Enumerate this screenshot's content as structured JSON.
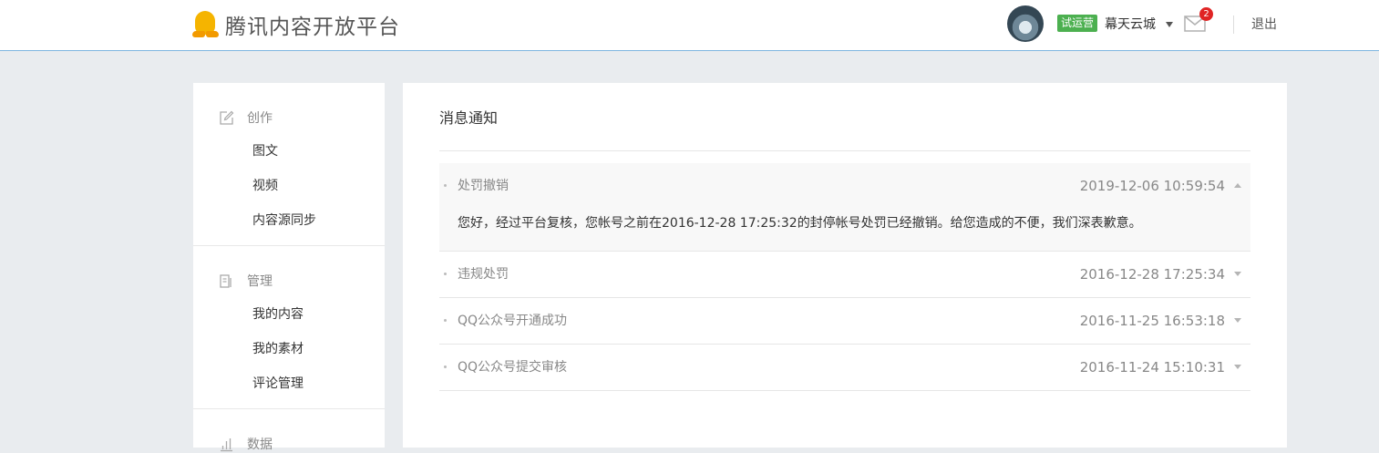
{
  "header": {
    "brand": "腾讯内容开放平台",
    "trial_badge": "试运营",
    "username": "幕天云城",
    "mail_count": "2",
    "logout": "退出"
  },
  "sidebar": {
    "groups": [
      {
        "label": "创作",
        "icon": "edit-icon",
        "items": [
          "图文",
          "视频",
          "内容源同步"
        ]
      },
      {
        "label": "管理",
        "icon": "manage-icon",
        "items": [
          "我的内容",
          "我的素材",
          "评论管理"
        ]
      },
      {
        "label": "数据",
        "icon": "chart-icon",
        "items": []
      }
    ]
  },
  "main": {
    "title": "消息通知",
    "messages": [
      {
        "title": "处罚撤销",
        "time": "2019-12-06 10:59:54",
        "expanded": true,
        "body": "您好，经过平台复核，您帐号之前在2016-12-28 17:25:32的封停帐号处罚已经撤销。给您造成的不便，我们深表歉意。"
      },
      {
        "title": "违规处罚",
        "time": "2016-12-28 17:25:34",
        "expanded": false
      },
      {
        "title": "QQ公众号开通成功",
        "time": "2016-11-25 16:53:18",
        "expanded": false
      },
      {
        "title": "QQ公众号提交审核",
        "time": "2016-11-24 15:10:31",
        "expanded": false
      }
    ]
  },
  "colors": {
    "accent_line": "#7fb6e0",
    "trial_badge": "#4cb050",
    "notice_badge": "#e02424",
    "brand_logo": "#f5b400"
  }
}
